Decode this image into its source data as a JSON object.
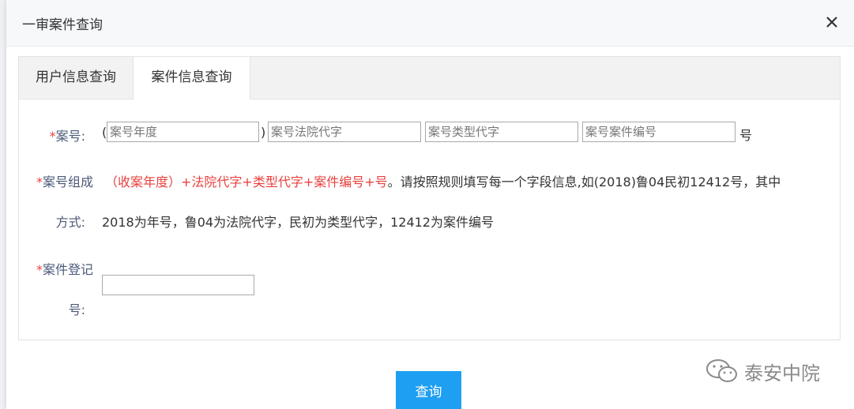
{
  "dialog": {
    "title": "一审案件查询"
  },
  "tabs": [
    {
      "label": "用户信息查询"
    },
    {
      "label": "案件信息查询"
    }
  ],
  "form": {
    "case_no": {
      "required_mark": "*",
      "label": "案号:",
      "open_paren": "(",
      "close_paren": ")",
      "year_placeholder": "案号年度",
      "court_placeholder": "案号法院代字",
      "type_placeholder": "案号类型代字",
      "serial_placeholder": "案号案件编号",
      "suffix": "号"
    },
    "format": {
      "required_mark": "*",
      "label_line1": "案号组成",
      "label_line2": "方式:",
      "rule_red": "（收案年度）+法院代字+类型代字+案件编号+号",
      "rule_black": "。请按照规则填写每一个字段信息,如(2018)鲁04民初12412号，其中",
      "example": "2018为年号，鲁04为法院代字，民初为类型代字，12412为案件编号"
    },
    "reg_no": {
      "required_mark": "*",
      "label_line1": "案件登记",
      "label_line2": "号:",
      "value": ""
    }
  },
  "actions": {
    "query_label": "查询"
  },
  "watermark": {
    "text": "泰安中院"
  }
}
